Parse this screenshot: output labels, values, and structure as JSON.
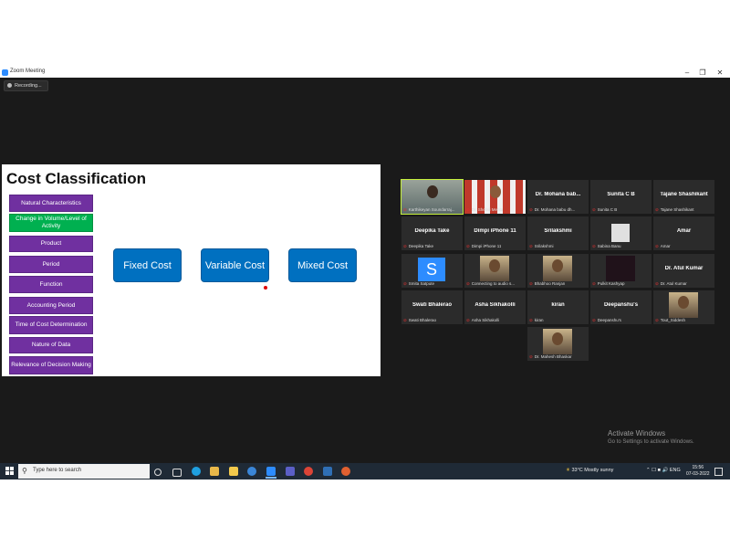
{
  "window": {
    "title": "Zoom Meeting",
    "controls": [
      "–",
      "❐",
      "✕"
    ]
  },
  "recording": {
    "label": "Recording..."
  },
  "slide": {
    "title": "Cost Classification",
    "left_items": [
      {
        "label": "Natural Characteristics",
        "color": "purple"
      },
      {
        "label": "Change in Volume/Level of Activity",
        "color": "green"
      },
      {
        "label": "Product",
        "color": "purple"
      },
      {
        "label": "Period",
        "color": "purple"
      },
      {
        "label": "Function",
        "color": "purple"
      },
      {
        "label": "Accounting Period",
        "color": "purple"
      },
      {
        "label": "Time of Cost Determination",
        "color": "purple"
      },
      {
        "label": "Nature of Data",
        "color": "purple"
      },
      {
        "label": "Relevance of Decision Making",
        "color": "purple"
      }
    ],
    "cost_types": [
      "Fixed Cost",
      "Variable Cost",
      "Mixed Cost"
    ]
  },
  "participants": [
    {
      "big": "",
      "small": "Karthikeyan Soundarraj...",
      "type": "video",
      "active": true
    },
    {
      "big": "",
      "small": "Dr. Shefali Mehta",
      "type": "video"
    },
    {
      "big": "Dr. Mohana bab...",
      "small": "Dr. Mohana babu dh...",
      "type": "name"
    },
    {
      "big": "Sunita C B",
      "small": "Sunita C B",
      "type": "name"
    },
    {
      "big": "Tajane Shashikant",
      "small": "Tajane Shashikant",
      "type": "name"
    },
    {
      "big": "Deepika Take",
      "small": "Deepika Take",
      "type": "name"
    },
    {
      "big": "Dimpi iPhone 11",
      "small": "Dimpi iPhone 11",
      "type": "name"
    },
    {
      "big": "Srilakshmi",
      "small": "Srilakshmi",
      "type": "name"
    },
    {
      "big": "",
      "small": "Sabina Banu",
      "type": "avatar"
    },
    {
      "big": "Amar",
      "small": "Amar",
      "type": "name"
    },
    {
      "big": "",
      "small": "Smita Satpute",
      "type": "letter",
      "letter": "S"
    },
    {
      "big": "",
      "small": "Connecting to audio s...",
      "type": "photo"
    },
    {
      "big": "",
      "small": "Bhabhoo Ranjan",
      "type": "photo"
    },
    {
      "big": "",
      "small": "Pulkit Kashyap",
      "type": "dark"
    },
    {
      "big": "Dr. Atul Kumar",
      "small": "Dr. Atul Kumar",
      "type": "name"
    },
    {
      "big": "Swati Bhalerao",
      "small": "Swati Bhalerao",
      "type": "name"
    },
    {
      "big": "Asha Sikhakolli",
      "small": "Asha Sikhakolli",
      "type": "name"
    },
    {
      "big": "kiran",
      "small": "kiran",
      "type": "name"
    },
    {
      "big": "Deepanshu's",
      "small": "Deepanshu's",
      "type": "name"
    },
    {
      "big": "",
      "small": "Tout_Siddesh",
      "type": "photo"
    },
    {
      "big": "",
      "small": "Dr. Mahesh Bhaskar",
      "type": "photo"
    }
  ],
  "activate_windows": {
    "line1": "Activate Windows",
    "line2": "Go to Settings to activate Windows."
  },
  "taskbar": {
    "search_placeholder": "Type here to search",
    "weather": "33°C  Mostly sunny",
    "language": "ENG",
    "time": "15:56",
    "date": "07-03-2022"
  },
  "colors": {
    "purple": "#7030a0",
    "green": "#00b050",
    "blue": "#0070c0",
    "active_speaker": "#c6f03c"
  }
}
